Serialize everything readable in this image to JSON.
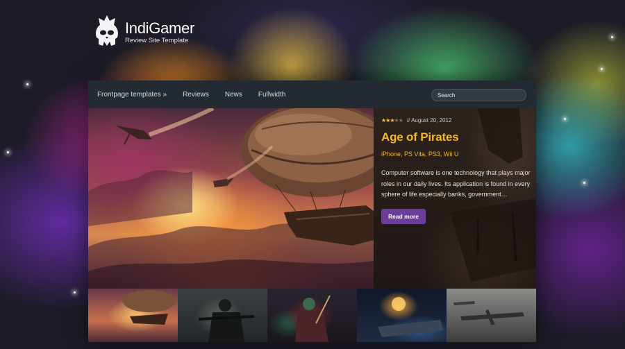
{
  "site": {
    "title": "IndiGamer",
    "subtitle": "Review Site Template"
  },
  "nav": {
    "items": [
      "Frontpage templates »",
      "Reviews",
      "News",
      "Fullwidth"
    ],
    "search_placeholder": "Search"
  },
  "featured": {
    "rating": 3,
    "rating_max": 5,
    "date": "// August 20, 2012",
    "title": "Age of Pirates",
    "platforms": "iPhone, PS Vita, PS3, Wii U",
    "excerpt": "Computer software is one technology that plays major roles in our daily lives. Its application is found in every sphere of life especially banks, government…",
    "read_more_label": "Read more"
  },
  "thumbnails": [
    "airship",
    "soldier",
    "fantasy-warrior",
    "space-battle",
    "aircraft"
  ],
  "colors": {
    "accent_gold": "#f3b928",
    "button_purple": "#6a3e9a",
    "nav_bg": "#262c34"
  }
}
